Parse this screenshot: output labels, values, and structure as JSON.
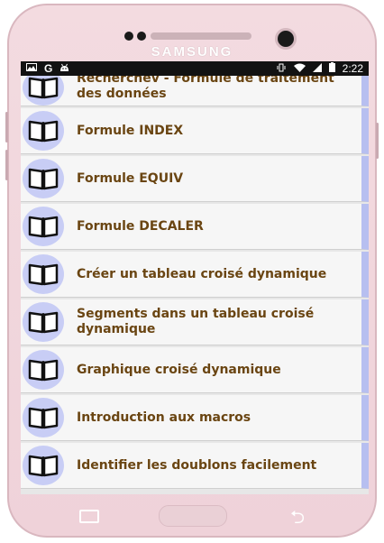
{
  "device": {
    "brand": "SAMSUNG"
  },
  "statusbar": {
    "time": "2:22",
    "left_icons": [
      "image-icon",
      "google-icon",
      "android-icon"
    ],
    "right_icons": [
      "vibrate-icon",
      "wifi-icon",
      "signal-icon",
      "battery-icon"
    ]
  },
  "list": {
    "items": [
      {
        "label": "Recherchev - Formule de traitement des données",
        "icon": "book-icon"
      },
      {
        "label": "Formule INDEX",
        "icon": "book-icon"
      },
      {
        "label": "Formule EQUIV",
        "icon": "book-icon"
      },
      {
        "label": "Formule DECALER",
        "icon": "book-icon"
      },
      {
        "label": "Créer un tableau croisé dynamique",
        "icon": "book-icon"
      },
      {
        "label": "Segments dans un tableau croisé dynamique",
        "icon": "book-icon"
      },
      {
        "label": "Graphique croisé dynamique",
        "icon": "book-icon"
      },
      {
        "label": "Introduction aux macros",
        "icon": "book-icon"
      },
      {
        "label": "Identifier les doublons facilement",
        "icon": "book-icon"
      }
    ]
  },
  "colors": {
    "label_text": "#6a4512",
    "accent_bar": "#b7bff0",
    "icon_circle": "#c8cdf5",
    "phone_body": "#f3dbe0"
  }
}
